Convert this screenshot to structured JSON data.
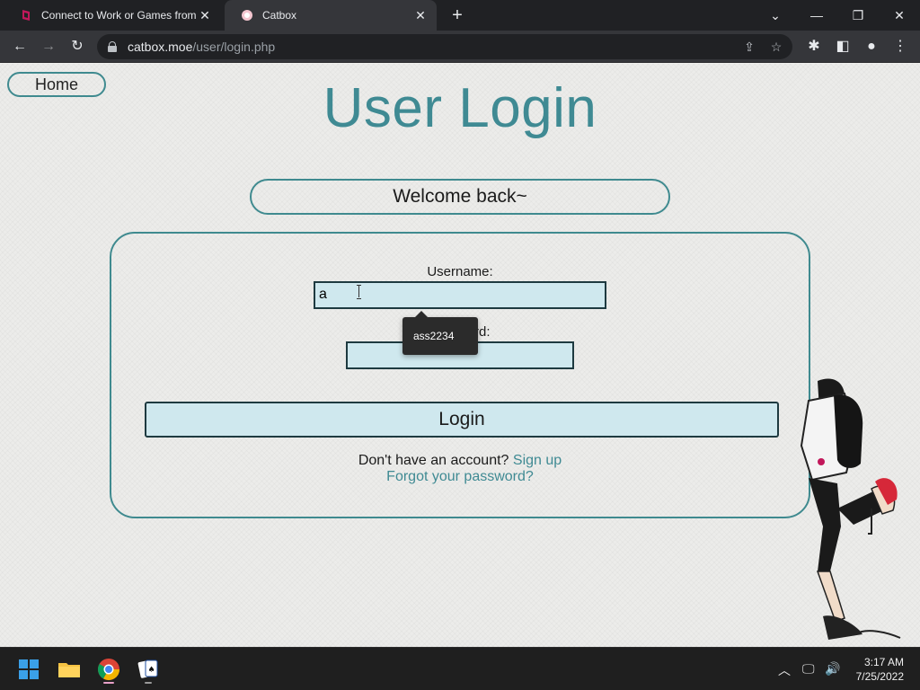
{
  "browser": {
    "tabs": [
      {
        "title": "Connect to Work or Games from",
        "favicon": "parsec-icon",
        "active": false
      },
      {
        "title": "Catbox",
        "favicon": "catbox-icon",
        "active": true
      }
    ],
    "url_host": "catbox.moe",
    "url_path": "/user/login.php"
  },
  "page": {
    "home_label": "Home",
    "title": "User Login",
    "welcome": "Welcome back~",
    "username_label": "Username:",
    "username_value": "a",
    "password_label_visible": "rd:",
    "password_value": "",
    "login_label": "Login",
    "no_account_text": "Don't have an account?",
    "signup_link": "Sign up",
    "forgot_link": "Forgot your password?",
    "autocomplete_suggestion": "ass2234",
    "accent_color": "#3f8a93",
    "input_bg_color": "#cfe8ee"
  },
  "taskbar": {
    "time": "3:17 AM",
    "date": "7/25/2022",
    "apps": [
      "start-icon",
      "file-explorer-icon",
      "chrome-icon",
      "solitaire-icon"
    ]
  }
}
